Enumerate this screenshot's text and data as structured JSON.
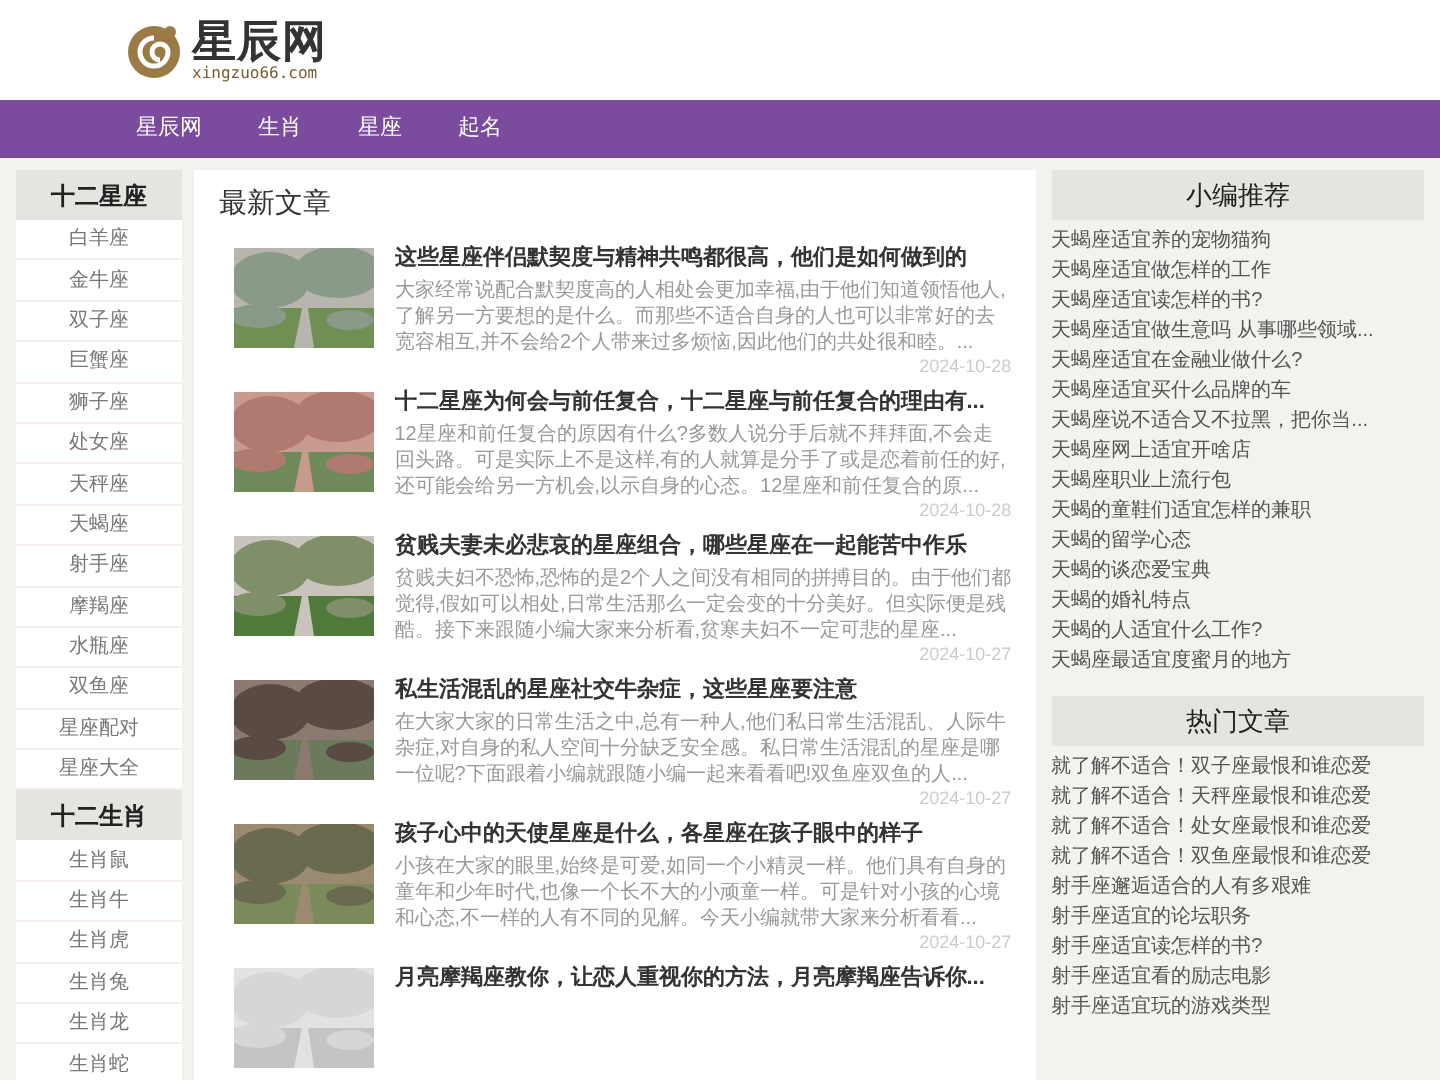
{
  "logo": {
    "name": "星辰网",
    "domain": "xingzuo66.com"
  },
  "nav": [
    {
      "label": "星辰网"
    },
    {
      "label": "生肖"
    },
    {
      "label": "星座"
    },
    {
      "label": "起名"
    }
  ],
  "left_sections": [
    {
      "title": "十二星座",
      "items": [
        "白羊座",
        "金牛座",
        "双子座",
        "巨蟹座",
        "狮子座",
        "处女座",
        "天秤座",
        "天蝎座",
        "射手座",
        "摩羯座",
        "水瓶座",
        "双鱼座",
        "星座配对",
        "星座大全"
      ]
    },
    {
      "title": "十二生肖",
      "items": [
        "生肖鼠",
        "生肖牛",
        "生肖虎",
        "生肖兔",
        "生肖龙",
        "生肖蛇"
      ]
    }
  ],
  "main": {
    "title": "最新文章",
    "articles": [
      {
        "title": "这些星座伴侣默契度与精神共鸣都很高，他们是如何做到的",
        "excerpt": "大家经常说配合默契度高的人相处会更加幸福,由于他们知道领悟他人,了解另一方要想的是什么。而那些不适合自身的人也可以非常好的去宽容相互,并不会给2个人带来过多烦恼,因此他们的共处很和睦。...",
        "date": "2024-10-28"
      },
      {
        "title": "十二星座为何会与前任复合，十二星座与前任复合的理由有...",
        "excerpt": "12星座和前任复合的原因有什么?多数人说分手后就不拜拜面,不会走回头路。可是实际上不是这样,有的人就算是分手了或是恋着前任的好,还可能会给另一方机会,以示自身的心态。12星座和前任复合的原...",
        "date": "2024-10-28"
      },
      {
        "title": "贫贱夫妻未必悲哀的星座组合，哪些星座在一起能苦中作乐",
        "excerpt": "贫贱夫妇不恐怖,恐怖的是2个人之间没有相同的拼搏目的。由于他们都觉得,假如可以相处,日常生活那么一定会变的十分美好。但实际便是残酷。接下来跟随小编大家来分析看,贫寒夫妇不一定可悲的星座...",
        "date": "2024-10-27"
      },
      {
        "title": "私生活混乱的星座社交牛杂症，这些星座要注意",
        "excerpt": "在大家大家的日常生活之中,总有一种人,他们私日常生活混乱、人际牛杂症,对自身的私人空间十分缺乏安全感。私日常生活混乱的星座是哪一位呢?下面跟着小编就跟随小编一起来看看吧!双鱼座双鱼的人...",
        "date": "2024-10-27"
      },
      {
        "title": "孩子心中的天使星座是什么，各星座在孩子眼中的样子",
        "excerpt": "小孩在大家的眼里,始终是可爱,如同一个小精灵一样。他们具有自身的童年和少年时代,也像一个长不大的小顽童一样。可是针对小孩的心境和心态,不一样的人有不同的见解。今天小编就带大家来分析看看...",
        "date": "2024-10-27"
      },
      {
        "title": "月亮摩羯座教你，让恋人重视你的方法，月亮摩羯座告诉你..."
      }
    ]
  },
  "right_sections": [
    {
      "title": "小编推荐",
      "items": [
        "天蝎座适宜养的宠物猫狗",
        "天蝎座适宜做怎样的工作",
        "天蝎座适宜读怎样的书?",
        "天蝎座适宜做生意吗 从事哪些领域...",
        "天蝎座适宜在金融业做什么?",
        "天蝎座适宜买什么品牌的车",
        "天蝎座说不适合又不拉黑，把你当...",
        "天蝎座网上适宜开啥店",
        "天蝎座职业上流行包",
        "天蝎的童鞋们适宜怎样的兼职",
        "天蝎的留学心态",
        "天蝎的谈恋爱宝典",
        "天蝎的婚礼特点",
        "天蝎的人适宜什么工作?",
        "天蝎座最适宜度蜜月的地方"
      ]
    },
    {
      "title": "热门文章",
      "items": [
        "就了解不适合！双子座最恨和谁恋爱",
        "就了解不适合！天秤座最恨和谁恋爱",
        "就了解不适合！处女座最恨和谁恋爱",
        "就了解不适合！双鱼座最恨和谁恋爱",
        "射手座邂逅适合的人有多艰难",
        "射手座适宜的论坛职务",
        "射手座适宜读怎样的书?",
        "射手座适宜看的励志电影",
        "射手座适宜玩的游戏类型"
      ]
    }
  ]
}
